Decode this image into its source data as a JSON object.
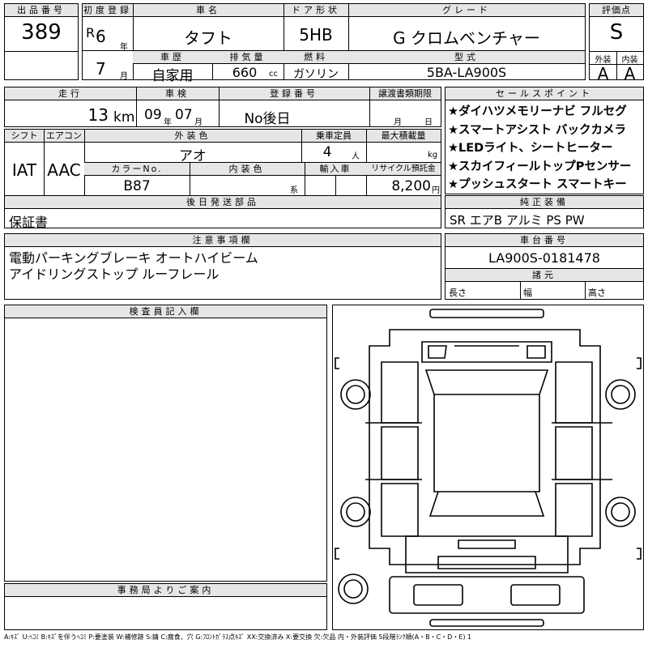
{
  "lot": {
    "label": "出品番号",
    "value": "389"
  },
  "first_reg": {
    "label": "初度登録",
    "era": "R",
    "year": "6",
    "year_unit": "年",
    "month": "7",
    "month_unit": "月"
  },
  "car_name": {
    "label": "車名",
    "value": "タフト"
  },
  "door": {
    "label": "ドア形状",
    "value": "5HB"
  },
  "grade": {
    "label": "グレード",
    "value": "G クロムベンチャー"
  },
  "score": {
    "label": "評価点",
    "value": "S"
  },
  "exterior_score": {
    "label": "外装",
    "value": "A"
  },
  "interior_score": {
    "label": "内装",
    "value": "A"
  },
  "history": {
    "label": "車歴",
    "value": "自家用"
  },
  "displacement": {
    "label": "排気量",
    "value": "660",
    "unit": "cc"
  },
  "fuel": {
    "label": "燃料",
    "value": "ガソリン"
  },
  "model_code": {
    "label": "型式",
    "value": "5BA-LA900S"
  },
  "mileage": {
    "label": "走行",
    "value": "13",
    "unit": "km"
  },
  "inspection": {
    "label": "車検",
    "year": "09",
    "year_unit": "年",
    "month": "07",
    "month_unit": "月"
  },
  "reg_number": {
    "label": "登録番号",
    "value": "No後日"
  },
  "transfer_deadline": {
    "label": "譲渡書類期限",
    "month_unit": "月",
    "day_unit": "日"
  },
  "sales_points": {
    "label": "セールスポイント",
    "items": [
      "★ダイハツメモリーナビ フルセグ",
      "★スマートアシスト バックカメラ",
      "★LEDライト、シートヒーター",
      "★スカイフィールトップPセンサー",
      "★プッシュスタート スマートキー"
    ]
  },
  "shift": {
    "label": "シフト",
    "value": "IAT"
  },
  "aircon": {
    "label": "エアコン",
    "value": "AAC"
  },
  "exterior_color": {
    "label": "外装色",
    "value": "アオ"
  },
  "capacity": {
    "label": "乗車定員",
    "value": "4",
    "unit": "人"
  },
  "max_load": {
    "label": "最大積載量",
    "unit": "kg"
  },
  "color_no": {
    "label": "カラーNo.",
    "value": "B87"
  },
  "interior_color": {
    "label": "内装色",
    "unit": "系"
  },
  "import": {
    "label": "輸入車"
  },
  "recycle": {
    "label": "リサイクル預託金",
    "value": "8,200",
    "unit": "円"
  },
  "later_items": {
    "label": "後日発送部品",
    "value": "保証書"
  },
  "standard_equipment": {
    "label": "純正装備",
    "value": "SR エアB アルミ PS PW"
  },
  "notes": {
    "label": "注意事項欄",
    "lines": [
      "電動パーキングブレーキ オートハイビーム",
      "アイドリングストップ ルーフレール"
    ]
  },
  "chassis": {
    "label": "車台番号",
    "value": "LA900S-0181478"
  },
  "specs": {
    "label": "諸元",
    "length": "長さ",
    "width": "幅",
    "height": "高さ"
  },
  "inspector": {
    "label": "検査員記入欄"
  },
  "office": {
    "label": "事務局よりご案内"
  },
  "legend": "A:ｷｽﾞ U:ﾍｺﾐ B:ｷｽﾞを伴うﾍｺﾐ P:要塗装 W:補修跡 S:錆 C:腐食、穴 G:ﾌﾛﾝﾄｶﾞﾗｽ点ｷｽﾞ XX:交換済み X:要交換 欠:欠品 内・外装評価 5段階ﾗﾝｸ順(A・B・C・D・E) 1"
}
